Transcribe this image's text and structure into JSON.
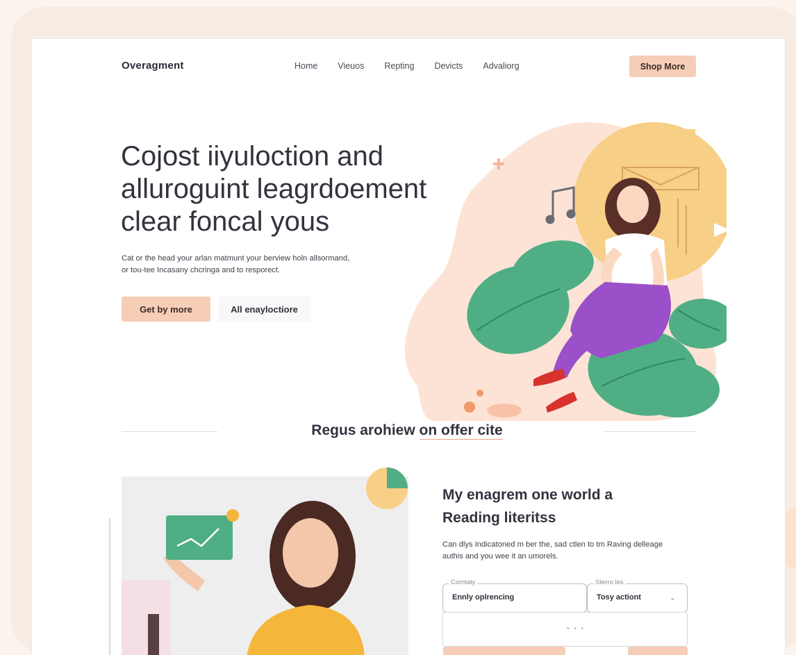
{
  "header": {
    "logo": "Overagment",
    "nav": [
      "Home",
      "Vieuos",
      "Repting",
      "Devicts",
      "Advaliorg"
    ],
    "cta": "Shop More"
  },
  "hero": {
    "title_lines": [
      "Cojost iiyuloction and",
      "alluroguint leagrdoement",
      "clear foncal yous"
    ],
    "subtitle_lines": [
      "Cat or the head your arlan matmunt your berview holn allsormand,",
      "or tou-tee Incasany chcringa and to resporect."
    ],
    "primary_button": "Get by more",
    "secondary_button": "All enayloctiore"
  },
  "section": {
    "title_plain": "Regus arohiew ",
    "title_underlined": "on offer cite"
  },
  "card": {
    "title_lines": [
      "My enagrem one world a",
      "Reading literitss"
    ],
    "subtitle_lines": [
      "Can dlys Indicatoned m ber the, sad ctlen to tm Raving delleage",
      "authis and you wee it an umorels."
    ],
    "field1": {
      "label": "Comtaty",
      "value": "Ennly oplrencing"
    },
    "field2": {
      "label": "Sterro les",
      "value": "Tosy actiont"
    },
    "textarea_dots": "• • •"
  },
  "colors": {
    "peach": "#f6cdb6",
    "blob": "#fde3d5",
    "sun": "#f7cf86",
    "leaf": "#4fae84",
    "purple": "#9b4fc8",
    "shoe": "#d9312c"
  },
  "icons": [
    "music-note-icon",
    "envelope-icon",
    "play-icon",
    "sparkle-icon",
    "trend-chart-icon",
    "pie-chart-icon"
  ]
}
